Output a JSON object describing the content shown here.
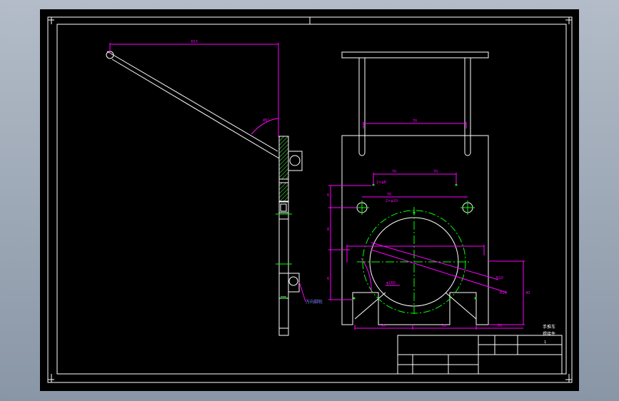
{
  "colors": {
    "background": "#000000",
    "frame": "#ffffff",
    "dimension": "#ff00ff",
    "center_line": "#00ff00",
    "section_hatch": "#2e8b2e",
    "note": "#8080ff"
  },
  "dimensions": {
    "arm_top_width": "653",
    "arm_angle": "45°",
    "handle_span": "70",
    "hole_pitch_top": "70",
    "hole_pitch_mid": "70",
    "hole_callout_top": "2×φ8",
    "hole_callout_mid": "2×φ10",
    "left_v1": "6",
    "left_v2": "8",
    "left_v3": "6",
    "ring_callout": "φ160",
    "radius_a": "R10",
    "radius_b": "R10",
    "bottom_1": "30",
    "bottom_2": "30",
    "bottom_3": "30",
    "right_height": "40",
    "mid_width": "70"
  },
  "notes": {
    "side_note": "万向脚轮"
  },
  "title_block": {
    "name_line1": "手推车",
    "name_line2": "焊接件",
    "scale": "1"
  }
}
